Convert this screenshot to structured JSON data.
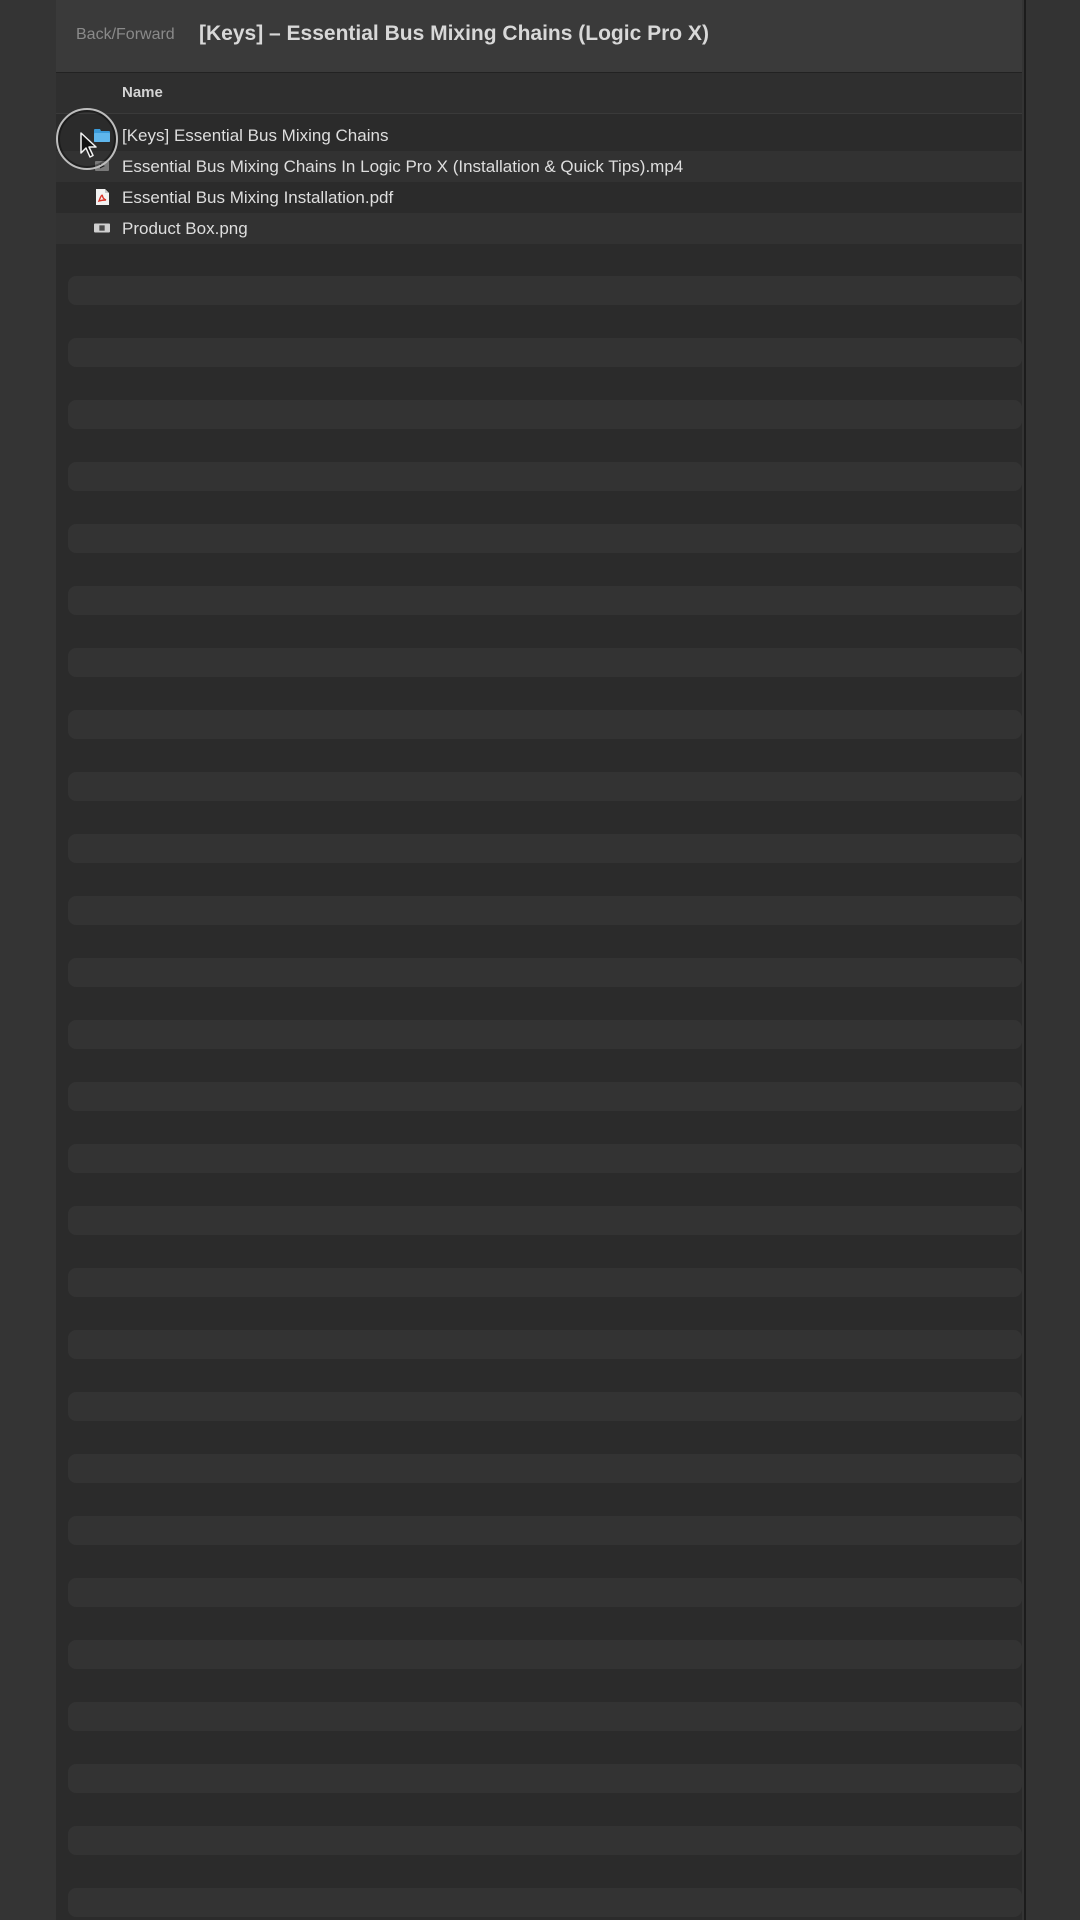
{
  "toolbar": {
    "nav_label": "Back/Forward",
    "title": "[Keys] – Essential Bus Mixing Chains (Logic Pro X)"
  },
  "list": {
    "column_name": "Name",
    "items": [
      {
        "label": "[Keys] Essential Bus Mixing Chains",
        "icon": "folder-icon"
      },
      {
        "label": "Essential Bus Mixing Chains In Logic Pro X (Installation & Quick Tips).mp4",
        "icon": "video-file-icon"
      },
      {
        "label": "Essential Bus Mixing Installation.pdf",
        "icon": "pdf-file-icon"
      },
      {
        "label": "Product Box.png",
        "icon": "image-file-icon"
      }
    ]
  },
  "colors": {
    "background": "#2b2b2b",
    "toolbar": "#3a3a3a",
    "folder_accent": "#3a9ad9",
    "pdf_accent": "#d9362b"
  }
}
